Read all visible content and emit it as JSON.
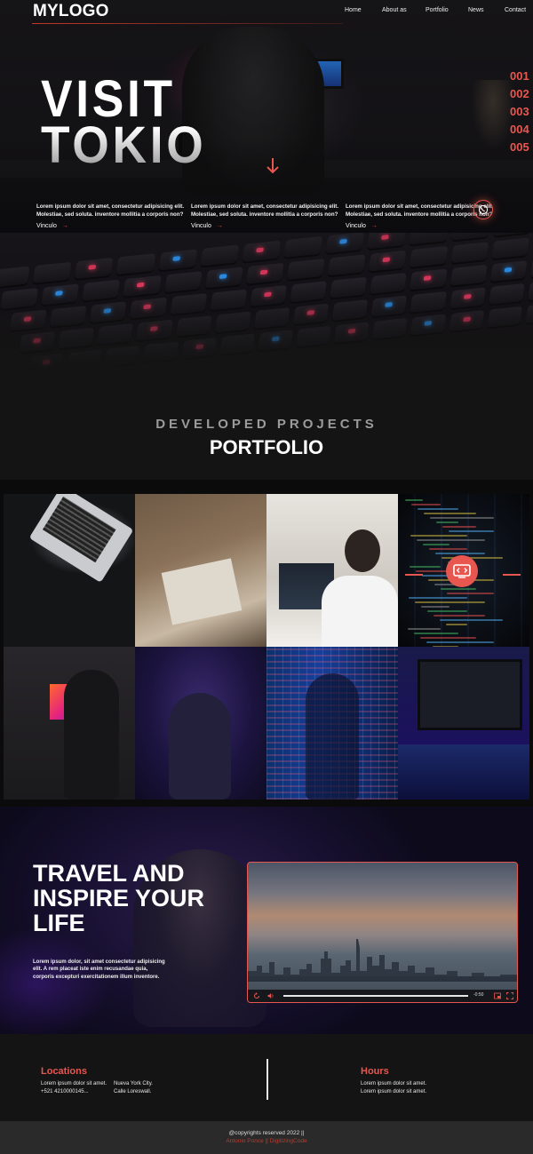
{
  "header": {
    "logo": "MYLOGO",
    "nav": [
      "Home",
      "About as",
      "Portfolio",
      "News",
      "Contact"
    ]
  },
  "hero": {
    "title_line1": "VISIT",
    "title_line2": "TOKIO",
    "slides": [
      "001",
      "002",
      "003",
      "004",
      "005"
    ],
    "columns": [
      {
        "text": "Lorem ipsum dolor sit amet, consectetur adipisicing elit. Molestiae, sed soluta. inventore mollitia a corporis non?",
        "link": "Vinculo"
      },
      {
        "text": "Lorem ipsum dolor sit amet, consectetur adipisicing elit. Molestiae, sed soluta. inventore mollitia a corporis non?",
        "link": "Vinculo"
      },
      {
        "text": "Lorem ipsum dolor sit amet, consectetur adipisicing elit. Molestiae, sed soluta. inventore mollitia a corporis non?",
        "link": "Vinculo"
      }
    ],
    "link_arrow": "→",
    "whatsapp_icon": "whatsapp-icon"
  },
  "portfolio": {
    "subtitle": "DEVELOPED PROJECTS",
    "title": "PORTFOLIO",
    "tiles": [
      "laptop-code",
      "desk-sketch",
      "developer-headphones",
      "code-screen",
      "gamer-setup",
      "developer-glasses",
      "code-projection",
      "code-editor"
    ],
    "overlay_icon": "code-icon"
  },
  "travel": {
    "title_line1": "TRAVEL AND",
    "title_line2": "INSPIRE YOUR",
    "title_line3": "LIFE",
    "text": "Lorem ipsum dolor, sit amet consectetur adipisicing elit. A rem placeat iste enim recusandae quia, corporis excepturi exercitationem illum inventore.",
    "video": {
      "time": "-0:50",
      "icons": [
        "replay-icon",
        "volume-icon",
        "pip-icon",
        "fullscreen-icon"
      ]
    }
  },
  "footer": {
    "locations_title": "Locations",
    "locations_lines": [
      "Lorem ipsum dolor sit amet.",
      "+521 4210000145..."
    ],
    "city_lines": [
      "Nueva York City.",
      "Calle Loreswall."
    ],
    "hours_title": "Hours",
    "hours_lines": [
      "Lorem ipsum dolor sit amet.",
      "Lorem ipsum dolor sit amet."
    ],
    "copyright": "@copyrights reserved 2022 ||",
    "credits": "Antonio Ponce || DigitizingCode"
  },
  "colors": {
    "accent": "#e8574f",
    "background": "#141414"
  }
}
